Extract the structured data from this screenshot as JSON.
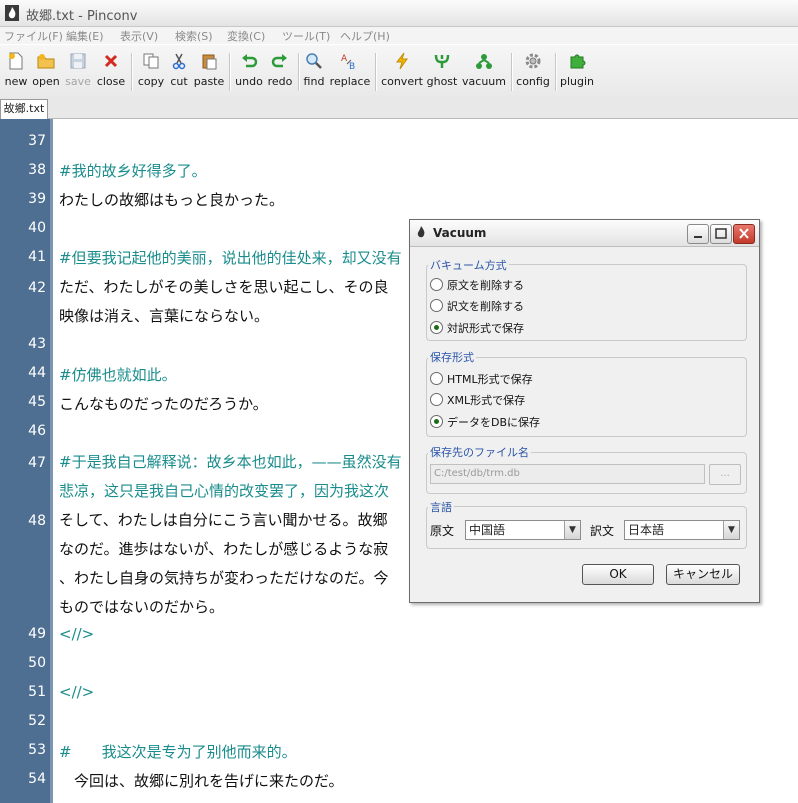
{
  "window": {
    "title": "故郷.txt - Pinconv"
  },
  "menu": [
    "ファイル(F)",
    "編集(E)",
    "表示(V)",
    "検索(S)",
    "変換(C)",
    "ツール(T)",
    "ヘルプ(H)"
  ],
  "toolbar": {
    "new": "new",
    "open": "open",
    "save": "save",
    "close": "close",
    "copy": "copy",
    "cut": "cut",
    "paste": "paste",
    "undo": "undo",
    "redo": "redo",
    "find": "find",
    "replace": "replace",
    "convert": "convert",
    "ghost": "ghost",
    "vacuum": "vacuum",
    "config": "config",
    "plugin": "plugin"
  },
  "tab": {
    "label": "故鄉.txt"
  },
  "gutter": {
    "line_numbers": [
      "37",
      "38",
      "39",
      "40",
      "41",
      "42",
      "43",
      "44",
      "45",
      "46",
      "47",
      "48",
      "49",
      "50",
      "51",
      "52",
      "53",
      "54"
    ]
  },
  "editor": {
    "lines": [
      "#我的故乡好得多了。",
      "わたしの故郷はもっと良かった。",
      "#但要我记起他的美丽，说出他的佳处来，却又没有",
      "ただ、わたしがその美しさを思い起こし、その良",
      "映像は消え、言葉にならない。",
      "#仿佛也就如此。",
      "こんなものだったのだろうか。",
      "#于是我自己解释说：故乡本也如此，——虽然没有",
      "悲凉，这只是我自己心情的改变罢了，因为我这次",
      "そして、わたしは自分にこう言い聞かせる。故郷",
      "なのだ。進歩はないが、わたしが感じるような寂",
      "、わたし自身の気持ちが変わっただけなのだ。今",
      "ものではないのだから。",
      "<//>",
      "<//>",
      "#　　我这次是专为了别他而来的。",
      "　今回は、故郷に別れを告げに来たのだ。"
    ]
  },
  "dialog": {
    "title": "Vacuum",
    "vacuum_group": {
      "title": "バキューム方式",
      "options": [
        "原文を削除する",
        "訳文を削除する",
        "対訳形式で保存"
      ],
      "selected": 2
    },
    "format_group": {
      "title": "保存形式",
      "options": [
        "HTML形式で保存",
        "XML形式で保存",
        "データをDBに保存"
      ],
      "selected": 2
    },
    "file_group": {
      "title": "保存先のファイル名",
      "path": "C:/test/db/trm.db",
      "browse": "..."
    },
    "lang_group": {
      "title": "言語",
      "source_label": "原文",
      "source_value": "中国語",
      "target_label": "訳文",
      "target_value": "日本語"
    },
    "ok": "OK",
    "cancel": "キャンセル"
  },
  "colors": {
    "gutter": "#4e6f91",
    "chinese_text": "#1a8c8c",
    "japanese_text": "#111111",
    "group_title": "#2a55a8"
  }
}
